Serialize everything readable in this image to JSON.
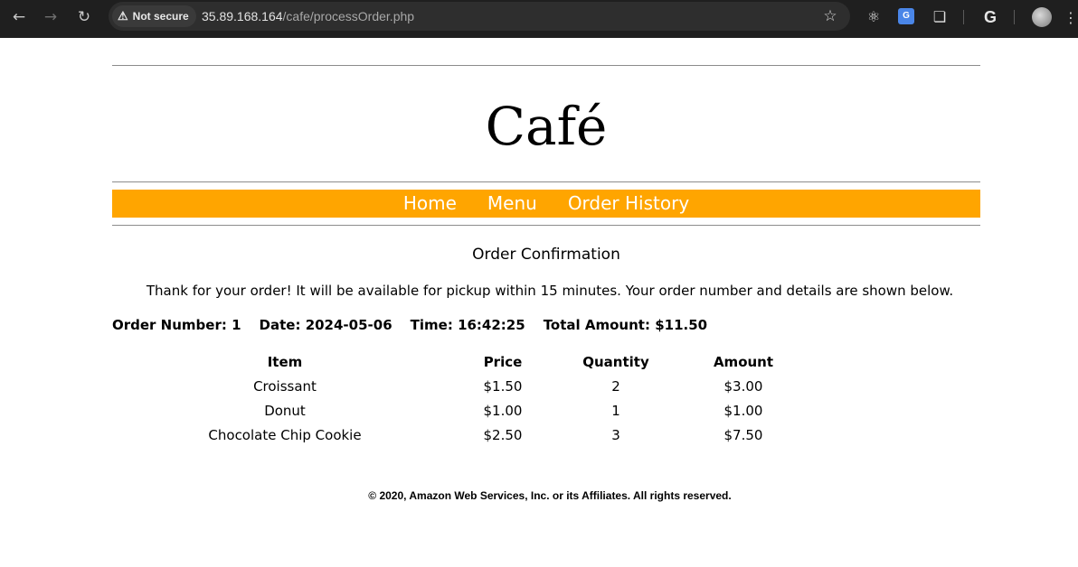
{
  "browser": {
    "back_icon": "arrow-left-icon",
    "forward_icon": "arrow-right-icon",
    "reload_icon": "reload-icon",
    "security_label": "Not secure",
    "url_host": "35.89.168.164",
    "url_path": "/cafe/processOrder.php",
    "bookmark_icon": "star-icon",
    "extensions": [
      "react-icon",
      "translate-icon",
      "puzzle-icon",
      "google-icon",
      "profile-avatar"
    ],
    "google_letter": "G",
    "translate_label": "G"
  },
  "site": {
    "title": "Café"
  },
  "nav": {
    "items": [
      {
        "label": "Home"
      },
      {
        "label": "Menu"
      },
      {
        "label": "Order History"
      }
    ]
  },
  "order": {
    "heading": "Order Confirmation",
    "message": "Thank for your order! It will be available for pickup within 15 minutes. Your order number and details are shown below.",
    "number_label": "Order Number:",
    "number": "1",
    "date_label": "Date:",
    "date": "2024-05-06",
    "time_label": "Time:",
    "time": "16:42:25",
    "total_label": "Total Amount:",
    "total": "$11.50",
    "columns": [
      "Item",
      "Price",
      "Quantity",
      "Amount"
    ],
    "items": [
      {
        "item": "Croissant",
        "price": "$1.50",
        "quantity": "2",
        "amount": "$3.00"
      },
      {
        "item": "Donut",
        "price": "$1.00",
        "quantity": "1",
        "amount": "$1.00"
      },
      {
        "item": "Chocolate Chip Cookie",
        "price": "$2.50",
        "quantity": "3",
        "amount": "$7.50"
      }
    ]
  },
  "footer": {
    "text": "© 2020, Amazon Web Services, Inc. or its Affiliates. All rights reserved."
  }
}
